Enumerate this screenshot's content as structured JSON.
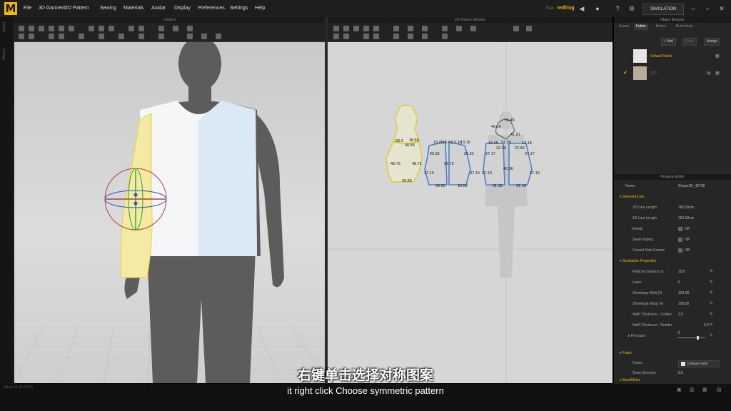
{
  "app": {
    "logo": "M"
  },
  "menu": [
    "File",
    "3D Garment",
    "2D Pattern",
    "Sewing",
    "Materials",
    "Avatar",
    "Display",
    "Preferences",
    "Settings",
    "Help"
  ],
  "user": {
    "label": "Trial",
    "name": "redfrog"
  },
  "simulation_label": "SIMULATION",
  "left_side_tabs": [
    "Library",
    "History"
  ],
  "viewport3d": {
    "title": "Untitled"
  },
  "viewport2d": {
    "title": "2D Pattern Window"
  },
  "object_browser": {
    "title": "Object Browser",
    "tabs": [
      "Scene",
      "Fabric",
      "Button",
      "Buttonhole"
    ],
    "active_tab": "Fabric",
    "buttons": {
      "add": "+ Add",
      "copy": "Copy",
      "assign": "Assign"
    },
    "fabrics": [
      {
        "name": "Default Fabric",
        "color": "#e6e6e6"
      },
      {
        "name": "TEP",
        "color": "#b8ab98"
      }
    ]
  },
  "property_editor": {
    "title": "Property Editor",
    "name_label": "Name",
    "name_value": "Shape2D_40735",
    "selected_line": {
      "section": "Selected Line",
      "rows": [
        {
          "label": "3D Line Length",
          "value": "182.20cm"
        },
        {
          "label": "2D Line Length",
          "value": "182.92cm"
        },
        {
          "label": "Elastic",
          "value": "Off"
        },
        {
          "label": "Seam Taping",
          "value": "Off"
        },
        {
          "label": "Curved Side Geome",
          "value": "Off"
        }
      ]
    },
    "simulation": {
      "section": "Simulation Properties",
      "rows": [
        {
          "label": "Particle Distance (n",
          "value": "20.0"
        },
        {
          "label": "Layer",
          "value": "0"
        },
        {
          "label": "Shrinkage Weft (%",
          "value": "100.00"
        },
        {
          "label": "Shrinkage Warp (%",
          "value": "100.00"
        },
        {
          "label": "Add'l Thickness - Collisic",
          "value": "2.5"
        },
        {
          "label": "Add'l Thickness - Render",
          "value": "0.0"
        }
      ],
      "pressure_label": "Pressure",
      "pressure_value": "0"
    },
    "fabric": {
      "section": "Fabric",
      "fabric_label": "Fabric",
      "fabric_value": "Default Fabri",
      "grain_label": "Grain Direction",
      "grain_value": "0.0",
      "next_section": "Bond/Skive"
    }
  },
  "pattern_labels": {
    "sleeve": [
      "29.3",
      "38.55",
      "40.55",
      "48.79",
      "48.71",
      "26.85"
    ],
    "front": [
      "13.45",
      "13.16",
      "26.32",
      "37.19",
      "30.59",
      "63.72",
      "26.32",
      "37.19",
      "30.59",
      "16.21",
      "13.16"
    ],
    "back": [
      "14.45",
      "40.36",
      "41.91",
      "31.35",
      "22.16",
      "13.18",
      "22.66",
      "27.17",
      "27.17",
      "37.19",
      "46.96",
      "37.19",
      "31.18",
      "31.18",
      "16.45"
    ]
  },
  "subtitle": {
    "chinese": "右键单击选择对称图案",
    "english": "it right click Choose symmetric pattern"
  },
  "status_text": "Mesh 11.3k (27%)"
}
